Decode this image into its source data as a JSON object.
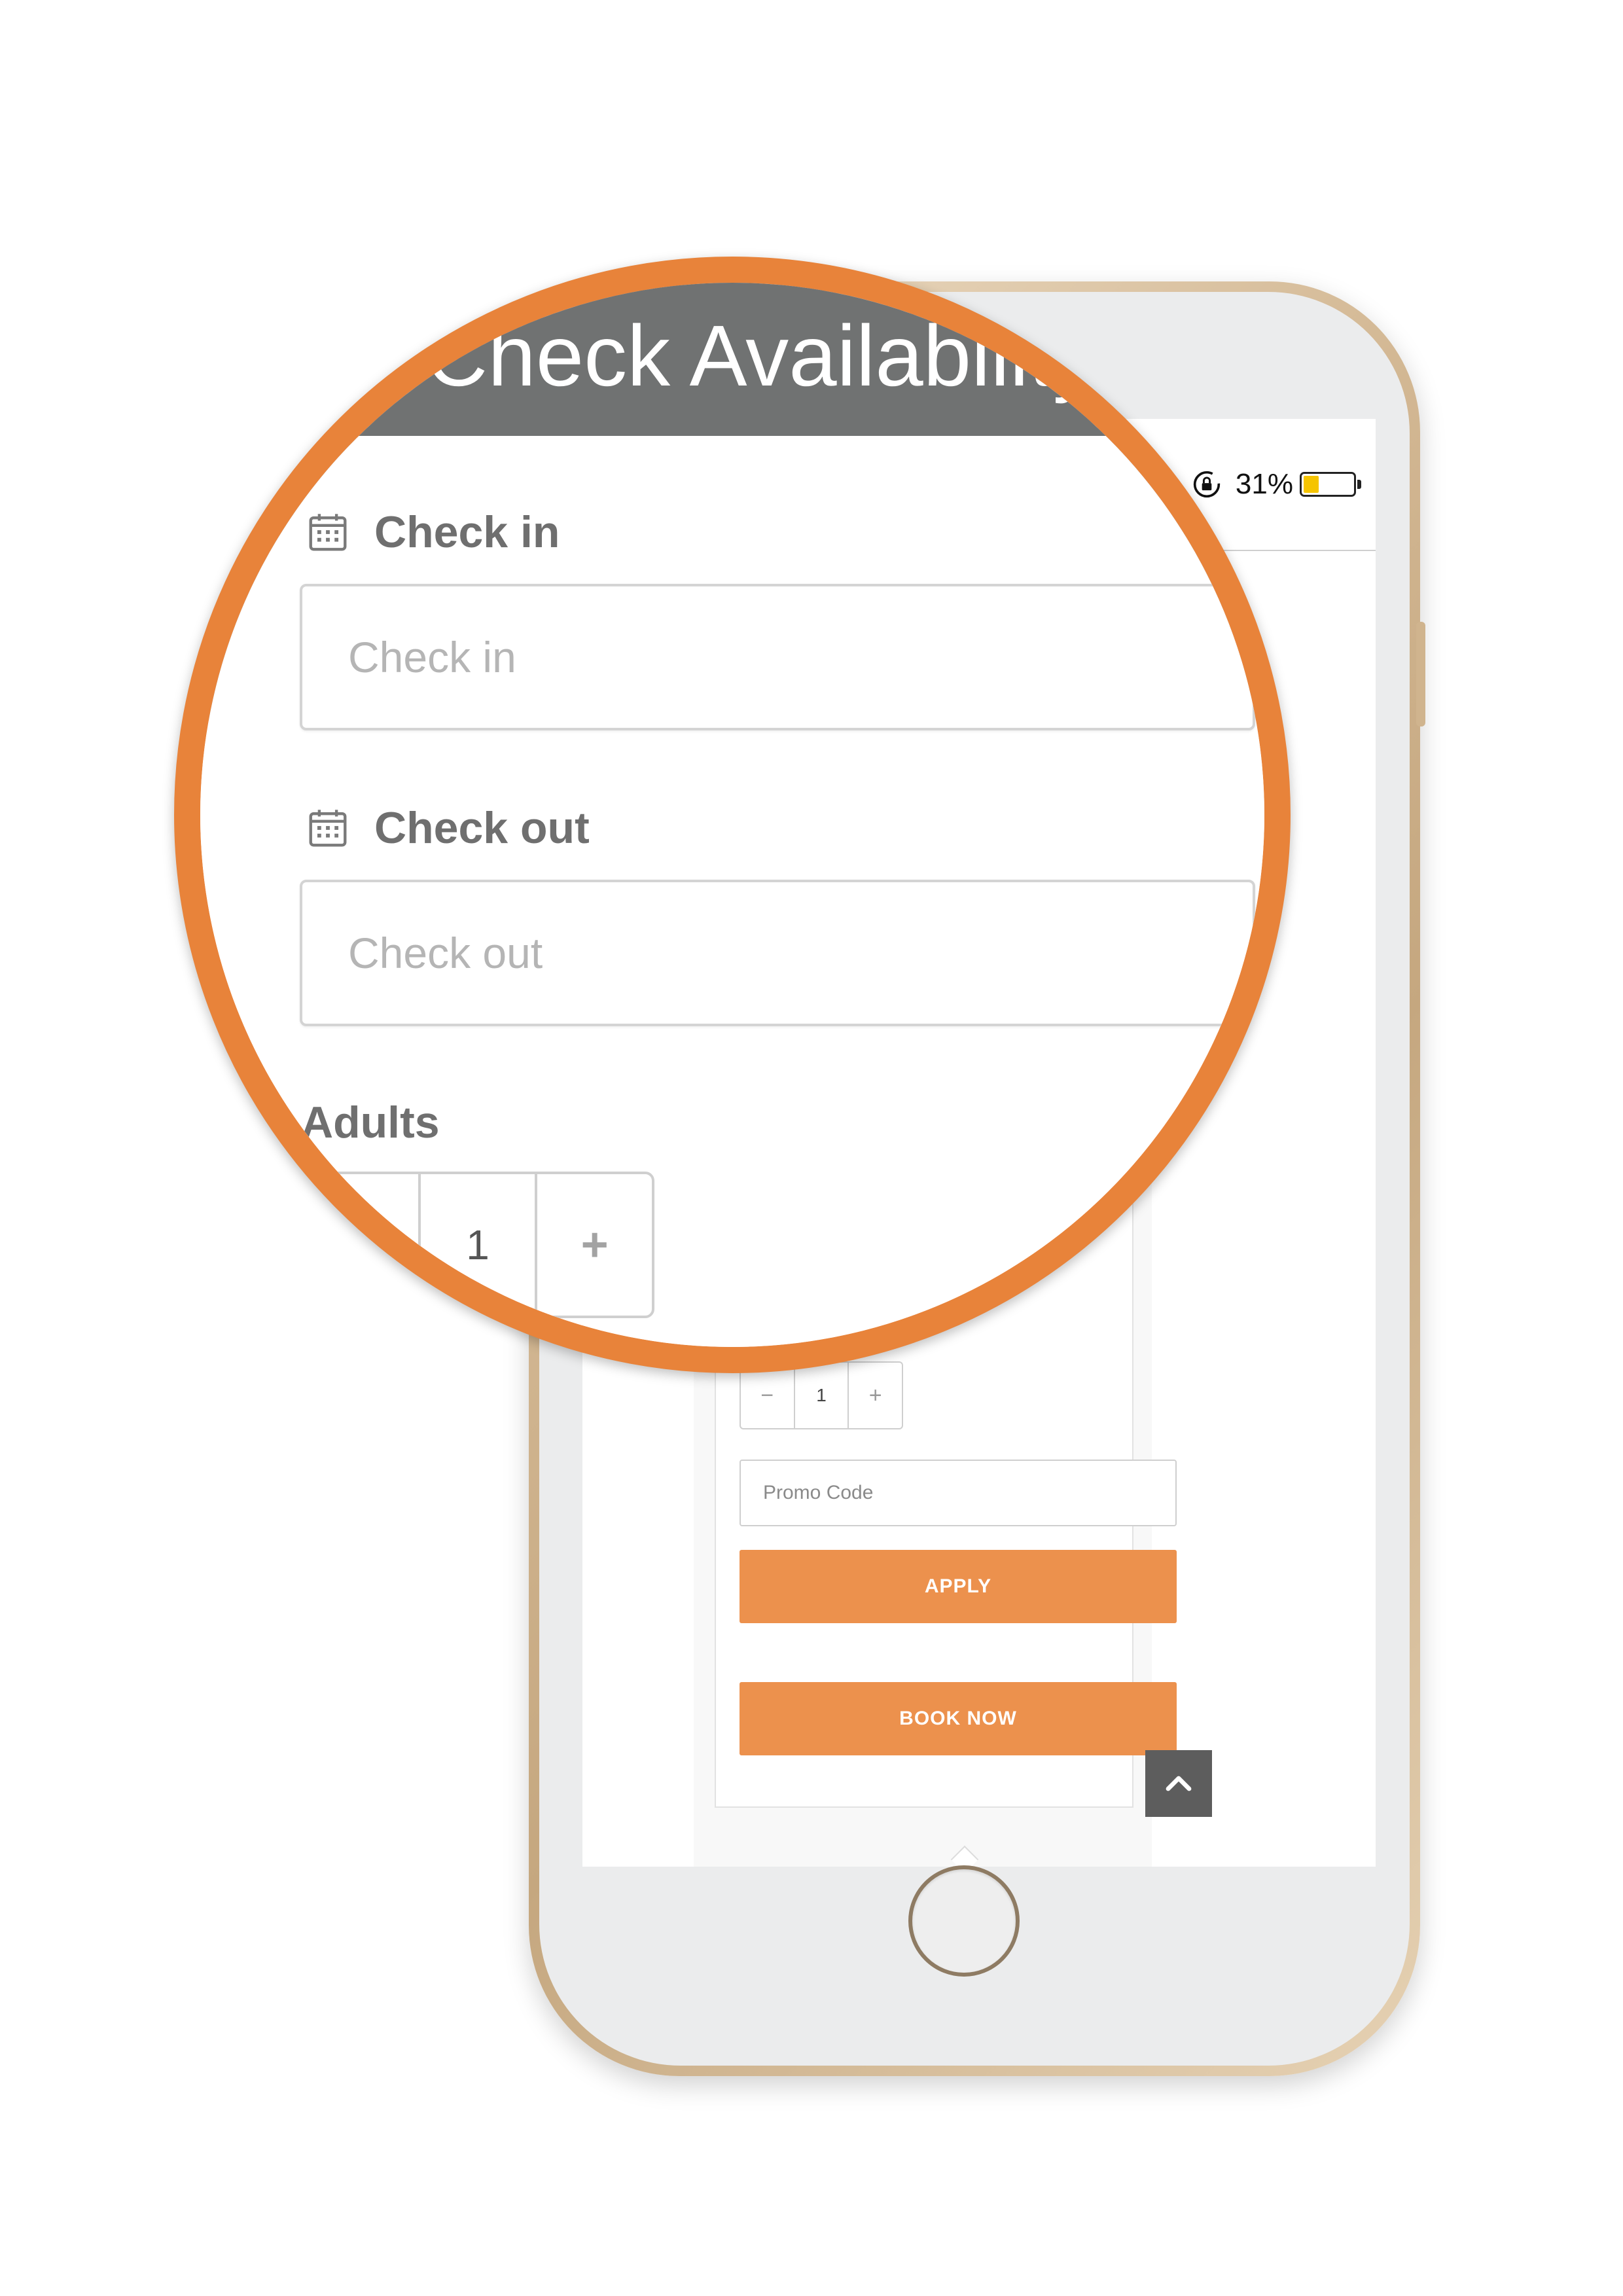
{
  "status_bar": {
    "battery_percent": "31%",
    "battery_level": 0.31,
    "battery_color": "#f5c400"
  },
  "magnified": {
    "header_title": "Check Availability",
    "check_in": {
      "label": "Check in",
      "placeholder": "Check in"
    },
    "check_out": {
      "label": "Check out",
      "placeholder": "Check out"
    },
    "adults": {
      "label": "Adults",
      "value": "1",
      "plus_symbol": "+"
    }
  },
  "booking": {
    "stepper": {
      "minus_symbol": "−",
      "value": "1",
      "plus_symbol": "+"
    },
    "promo": {
      "placeholder": "Promo Code"
    },
    "apply_label": "APPLY",
    "book_label": "BOOK NOW"
  },
  "colors": {
    "accent": "#ec914d",
    "magnifier_ring": "#e8833a",
    "header_gray": "#707272"
  },
  "icons": [
    "lock-rotation-icon",
    "battery-icon",
    "calendar-icon",
    "chevron-up-icon"
  ]
}
